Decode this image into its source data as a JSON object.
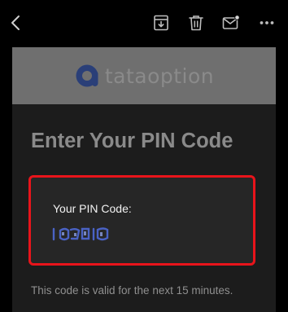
{
  "toolbar": {
    "back_icon": "chevron-left-icon",
    "archive_icon": "archive-download-icon",
    "delete_icon": "trash-icon",
    "mark_unread_icon": "mail-dot-icon",
    "more_icon": "more-horizontal-icon"
  },
  "email": {
    "brand": {
      "logo_text": "tataoption",
      "logo_icon": "brand-a-icon"
    },
    "heading": "Enter Your PIN Code",
    "pin_card": {
      "label": "Your PIN Code:",
      "value_obscured": true
    },
    "footer_note": "This code is valid for the next 15 minutes."
  },
  "colors": {
    "page_bg": "#000000",
    "email_bg": "#1c1c1c",
    "banner_bg": "#6f6f6f",
    "heading_text": "#8a8a8a",
    "highlight_border": "#e8141b",
    "pin_digits": "#4a62c4"
  }
}
